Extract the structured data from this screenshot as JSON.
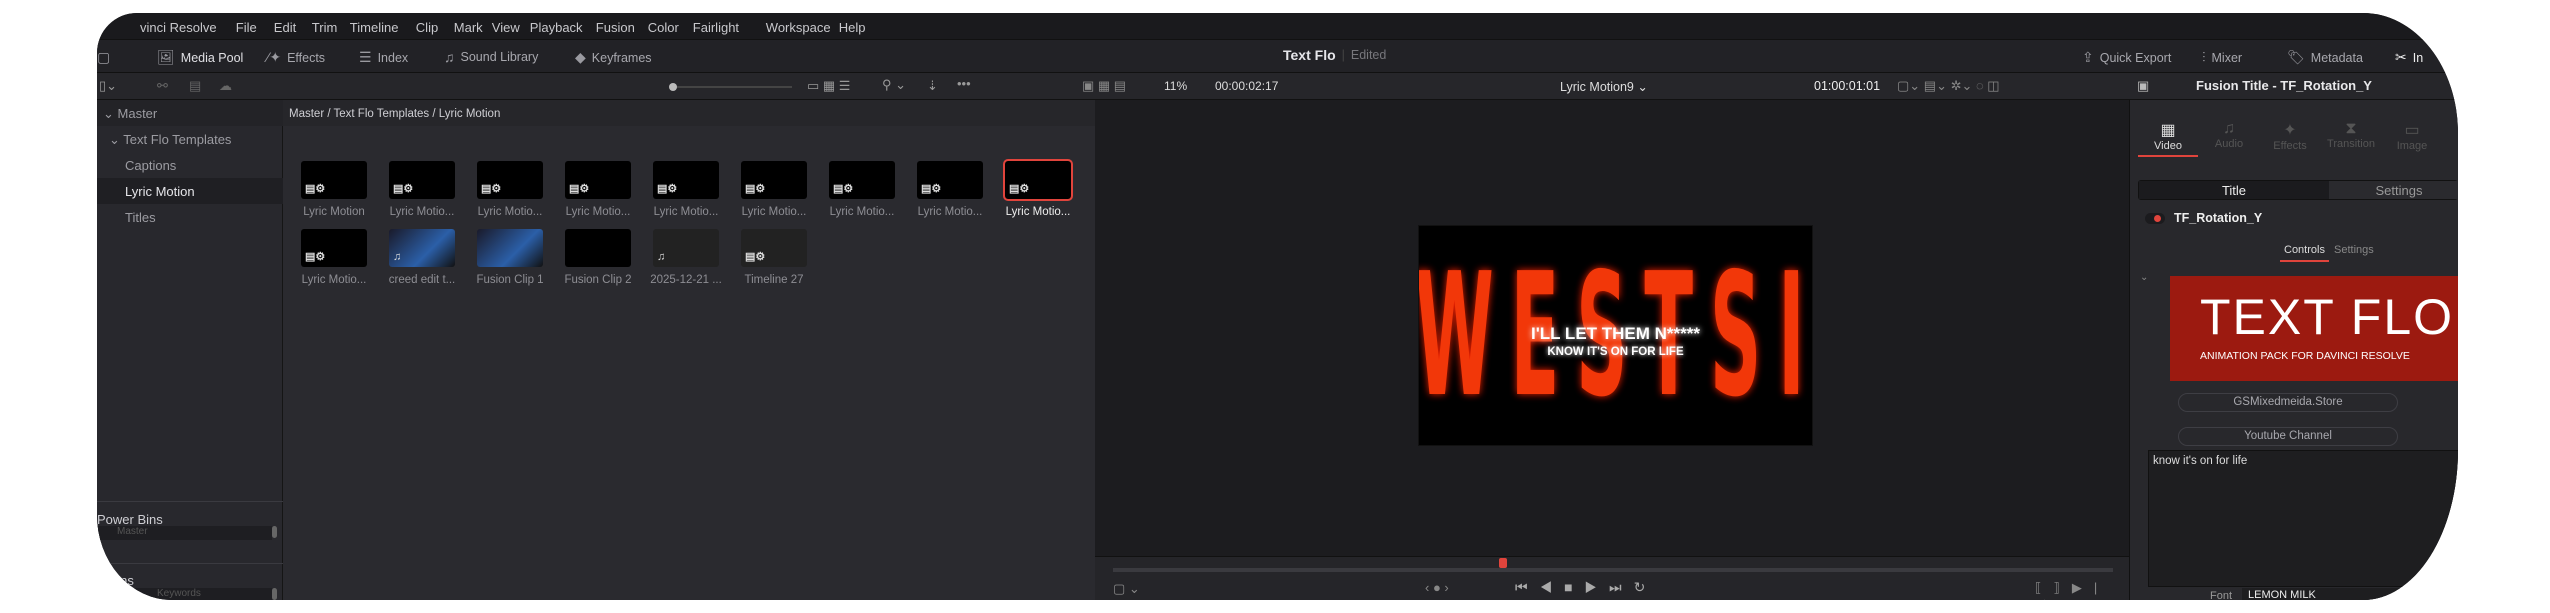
{
  "menu": [
    "vinci Resolve",
    "File",
    "Edit",
    "Trim",
    "Timeline",
    "Clip",
    "Mark",
    "View",
    "Playback",
    "Fusion",
    "Color",
    "Fairlight",
    "Workspace",
    "Help"
  ],
  "toolbar": {
    "media_pool": "Media Pool",
    "effects": "Effects",
    "index": "Index",
    "sound_library": "Sound Library",
    "keyframes": "Keyframes",
    "project_title": "Text Flo",
    "project_status": "Edited",
    "quick_export": "Quick Export",
    "mixer": "Mixer",
    "metadata": "Metadata",
    "inspector": "In"
  },
  "sidebar": {
    "master": "Master",
    "items": [
      {
        "label": "Text Flo Templates"
      },
      {
        "label": "Captions"
      },
      {
        "label": "Lyric Motion"
      },
      {
        "label": "Titles"
      }
    ],
    "power_bins": "Power Bins",
    "power_bins_item": "Master",
    "smart_bins": "rt Bins",
    "smart_bins_item": "Keywords"
  },
  "bins": {
    "breadcrumb": "Master / Text Flo Templates / Lyric Motion",
    "clips": [
      {
        "label": "Lyric Motion",
        "type": "title"
      },
      {
        "label": "Lyric Motio...",
        "type": "title"
      },
      {
        "label": "Lyric Motio...",
        "type": "title"
      },
      {
        "label": "Lyric Motio...",
        "type": "title"
      },
      {
        "label": "Lyric Motio...",
        "type": "title"
      },
      {
        "label": "Lyric Motio...",
        "type": "title"
      },
      {
        "label": "Lyric Motio...",
        "type": "title"
      },
      {
        "label": "Lyric Motio...",
        "type": "title"
      },
      {
        "label": "Lyric Motio...",
        "type": "title",
        "selected": true
      },
      {
        "label": "Lyric Motio...",
        "type": "title"
      },
      {
        "label": "creed edit t...",
        "type": "audio-video"
      },
      {
        "label": "Fusion Clip 1",
        "type": "video"
      },
      {
        "label": "Fusion Clip 2",
        "type": "video"
      },
      {
        "label": "2025-12-21 ...",
        "type": "audio"
      },
      {
        "label": "Timeline 27",
        "type": "timeline"
      }
    ]
  },
  "viewer": {
    "zoom": "11%",
    "duration": "00:00:02:17",
    "timeline_name": "Lyric Motion9",
    "timecode": "01:00:01:01",
    "frame_big_text": "WESTSIDE",
    "lyric_line1": "I'LL LET THEM N*****",
    "lyric_line2": "KNOW IT'S ON FOR LIFE",
    "playhead_fraction": 0.39
  },
  "inspector": {
    "title": "Fusion Title - TF_Rotation_Y",
    "tabs": [
      "Video",
      "Audio",
      "Effects",
      "Transition",
      "Image"
    ],
    "active_tab": "Video",
    "segments": [
      "Title",
      "Settings"
    ],
    "node_name": "TF_Rotation_Y",
    "subtabs": [
      "Controls",
      "Settings"
    ],
    "banner_title": "TEXT FLO",
    "banner_sub": "ANIMATION PACK FOR DAVINCI RESOLVE",
    "store_button": "GSMixedmeida.Store",
    "youtube_button": "Youtube Channel",
    "text_value": "know it's on for life",
    "font_label": "Font",
    "font_value": "LEMON MILK"
  },
  "colors": {
    "accent": "#e0443c",
    "banner": "#9c1a10",
    "frame_text": "#ff3a0a"
  }
}
